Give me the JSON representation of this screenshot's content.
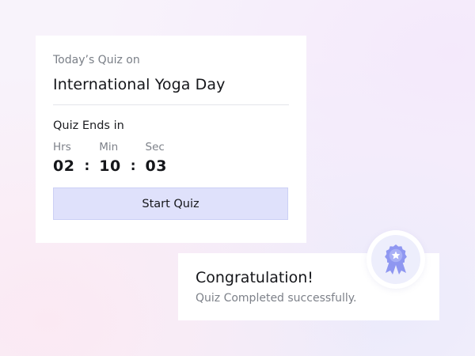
{
  "quiz": {
    "subtitle": "Today’s Quiz on",
    "title": "International Yoga Day",
    "ends_label": "Quiz Ends in",
    "timer": {
      "hours_label": "Hrs",
      "minutes_label": "Min",
      "seconds_label": "Sec",
      "hours": "02",
      "minutes": "10",
      "seconds": "03",
      "separator": ":"
    },
    "start_label": "Start Quiz"
  },
  "congrats": {
    "title": "Congratulation!",
    "message": "Quiz Completed successfully."
  },
  "icons": {
    "badge": "award-ribbon-icon"
  },
  "colors": {
    "accent": "#dfe1fb",
    "badge": "#8f97f1"
  }
}
